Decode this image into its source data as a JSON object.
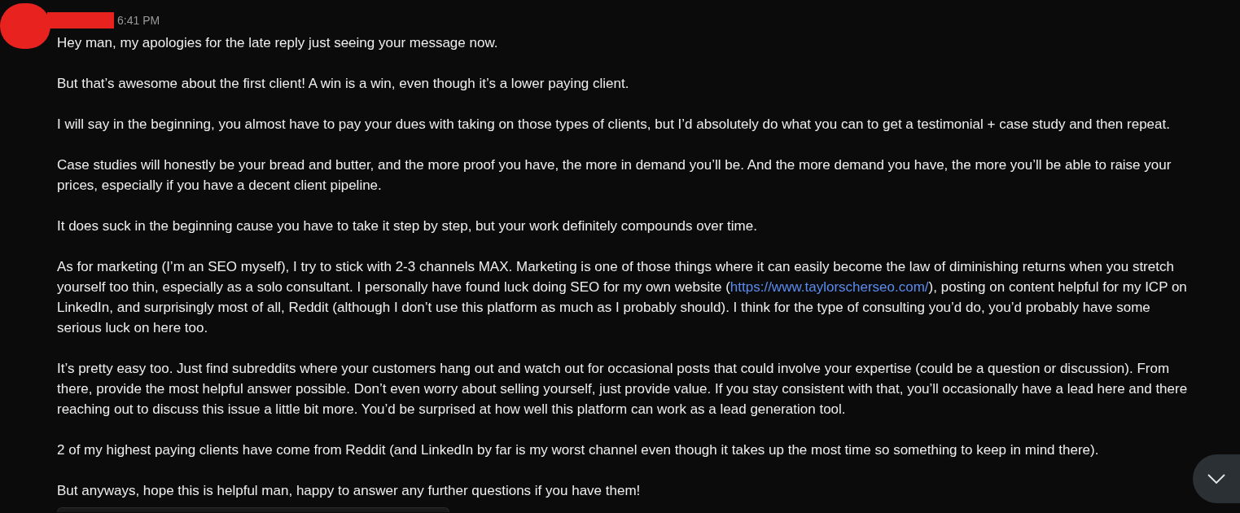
{
  "message": {
    "timestamp": "6:41 PM",
    "paragraphs": [
      [
        {
          "kind": "text",
          "text": "Hey man, my apologies for the late reply just seeing your message now."
        }
      ],
      [
        {
          "kind": "text",
          "text": "But that’s awesome about the first client! A win is a win, even though it’s a lower paying client."
        }
      ],
      [
        {
          "kind": "text",
          "text": "I will say in the beginning, you almost have to pay your dues with taking on those types of clients, but I’d absolutely do what you can to get a testimonial + case study and then repeat."
        }
      ],
      [
        {
          "kind": "text",
          "text": "Case studies will honestly be your bread and butter, and the more proof you have, the more in demand you’ll be. And the more demand you have, the more you’ll be able to raise your prices, especially if you have a decent client pipeline."
        }
      ],
      [
        {
          "kind": "text",
          "text": "It does suck in the beginning cause you have to take it step by step, but your work definitely compounds over time."
        }
      ],
      [
        {
          "kind": "text",
          "text": "As for marketing (I’m an SEO myself), I try to stick with 2-3 channels MAX. Marketing is one of those things where it can easily become the law of diminishing returns when you stretch yourself too thin, especially as a solo consultant. I personally have found luck doing SEO for my own website ("
        },
        {
          "kind": "link",
          "text": "https://www.taylorscherseo.com/"
        },
        {
          "kind": "text",
          "text": "), posting on content helpful for my ICP on LinkedIn, and surprisingly most of all, Reddit (although I don’t use this platform as much as I probably should). I think for the type of consulting you’d do, you’d probably have some serious luck on here too."
        }
      ],
      [
        {
          "kind": "text",
          "text": "It’s pretty easy too. Just find subreddits where your customers hang out and watch out for occasional posts that could involve your expertise (could be a question or discussion). From there, provide the most helpful answer possible. Don’t even worry about selling yourself, just provide value. If you stay consistent with that, you’ll occasionally have a lead here and there reaching out to discuss this issue a little bit more. You’d be surprised at how well this platform can work as a lead generation tool."
        }
      ],
      [
        {
          "kind": "text",
          "text": "2 of my highest paying clients have come from Reddit (and LinkedIn by far is my worst channel even though it takes up the most time so something to keep in mind there)."
        }
      ],
      [
        {
          "kind": "text",
          "text": "But anyways, hope this is helpful man, happy to answer any further questions if you have them!"
        }
      ]
    ]
  }
}
